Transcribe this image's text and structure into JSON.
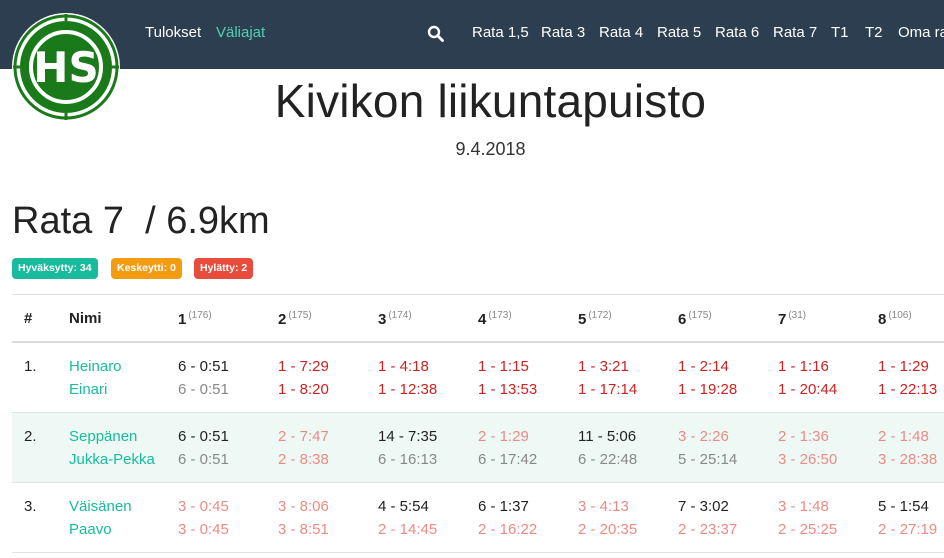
{
  "nav": {
    "links": [
      "Tulokset",
      "Väliajat"
    ],
    "routes": [
      "Rata 1,5",
      "Rata 3",
      "Rata 4",
      "Rata 5",
      "Rata 6",
      "Rata 7",
      "T1",
      "T2",
      "Oma ra"
    ]
  },
  "event": {
    "title": "Kivikon liikuntapuisto",
    "date": "9.4.2018"
  },
  "route": {
    "title": "Rata 7  / 6.9km"
  },
  "badges": {
    "ok": "Hyväksytty: 34",
    "dnf": "Keskeytti: 0",
    "dq": "Hylätty: 2"
  },
  "table": {
    "headers": [
      "#",
      "Nimi"
    ],
    "controls": [
      {
        "num": "1",
        "code": "(176)"
      },
      {
        "num": "2",
        "code": "(175)"
      },
      {
        "num": "3",
        "code": "(174)"
      },
      {
        "num": "4",
        "code": "(173)"
      },
      {
        "num": "5",
        "code": "(172)"
      },
      {
        "num": "6",
        "code": "(175)"
      },
      {
        "num": "7",
        "code": "(31)"
      },
      {
        "num": "8",
        "code": "(106)"
      }
    ],
    "rows": [
      {
        "rank": "1.",
        "last": "Heinaro",
        "first": "Einari",
        "splits": [
          {
            "leg": "6 - 0:51",
            "legc": "black",
            "cum": "6 - 0:51",
            "cumc": "grey"
          },
          {
            "leg": "1 - 7:29",
            "legc": "red",
            "cum": "1 - 8:20",
            "cumc": "red"
          },
          {
            "leg": "1 - 4:18",
            "legc": "red",
            "cum": "1 - 12:38",
            "cumc": "red"
          },
          {
            "leg": "1 - 1:15",
            "legc": "red",
            "cum": "1 - 13:53",
            "cumc": "red"
          },
          {
            "leg": "1 - 3:21",
            "legc": "red",
            "cum": "1 - 17:14",
            "cumc": "red"
          },
          {
            "leg": "1 - 2:14",
            "legc": "red",
            "cum": "1 - 19:28",
            "cumc": "red"
          },
          {
            "leg": "1 - 1:16",
            "legc": "red",
            "cum": "1 - 20:44",
            "cumc": "red"
          },
          {
            "leg": "1 - 1:29",
            "legc": "red",
            "cum": "1 - 22:13",
            "cumc": "red"
          }
        ]
      },
      {
        "rank": "2.",
        "last": "Seppänen",
        "first": "Jukka-Pekka",
        "splits": [
          {
            "leg": "6 - 0:51",
            "legc": "black",
            "cum": "6 - 0:51",
            "cumc": "grey"
          },
          {
            "leg": "2 - 7:47",
            "legc": "pink",
            "cum": "2 - 8:38",
            "cumc": "pink"
          },
          {
            "leg": "14 - 7:35",
            "legc": "black",
            "cum": "6 - 16:13",
            "cumc": "grey"
          },
          {
            "leg": "2 - 1:29",
            "legc": "pink",
            "cum": "6 - 17:42",
            "cumc": "grey"
          },
          {
            "leg": "11 - 5:06",
            "legc": "black",
            "cum": "6 - 22:48",
            "cumc": "grey"
          },
          {
            "leg": "3 - 2:26",
            "legc": "pink",
            "cum": "5 - 25:14",
            "cumc": "grey"
          },
          {
            "leg": "2 - 1:36",
            "legc": "pink",
            "cum": "3 - 26:50",
            "cumc": "pink"
          },
          {
            "leg": "2 - 1:48",
            "legc": "pink",
            "cum": "3 - 28:38",
            "cumc": "pink"
          }
        ]
      },
      {
        "rank": "3.",
        "last": "Väisänen",
        "first": "Paavo",
        "splits": [
          {
            "leg": "3 - 0:45",
            "legc": "pink",
            "cum": "3 - 0:45",
            "cumc": "pink"
          },
          {
            "leg": "3 - 8:06",
            "legc": "pink",
            "cum": "3 - 8:51",
            "cumc": "pink"
          },
          {
            "leg": "4 - 5:54",
            "legc": "black",
            "cum": "2 - 14:45",
            "cumc": "pink"
          },
          {
            "leg": "6 - 1:37",
            "legc": "black",
            "cum": "2 - 16:22",
            "cumc": "pink"
          },
          {
            "leg": "3 - 4:13",
            "legc": "pink",
            "cum": "2 - 20:35",
            "cumc": "pink"
          },
          {
            "leg": "7 - 3:02",
            "legc": "black",
            "cum": "2 - 23:37",
            "cumc": "pink"
          },
          {
            "leg": "3 - 1:48",
            "legc": "pink",
            "cum": "2 - 25:25",
            "cumc": "pink"
          },
          {
            "leg": "5 - 1:54",
            "legc": "black",
            "cum": "2 - 27:19",
            "cumc": "pink"
          }
        ]
      }
    ]
  },
  "colors": {
    "navbar": "#2c3e50",
    "accent": "#18bc9c",
    "warning": "#f39c12",
    "danger": "#e74c3c",
    "best": "#cc2222",
    "good": "#ec8b84",
    "cumulative": "#888888",
    "logo": "#1a7a1a"
  },
  "logo": {
    "text": "HS",
    "icon": "club-logo-icon"
  },
  "icons": {
    "search": "search-icon"
  }
}
